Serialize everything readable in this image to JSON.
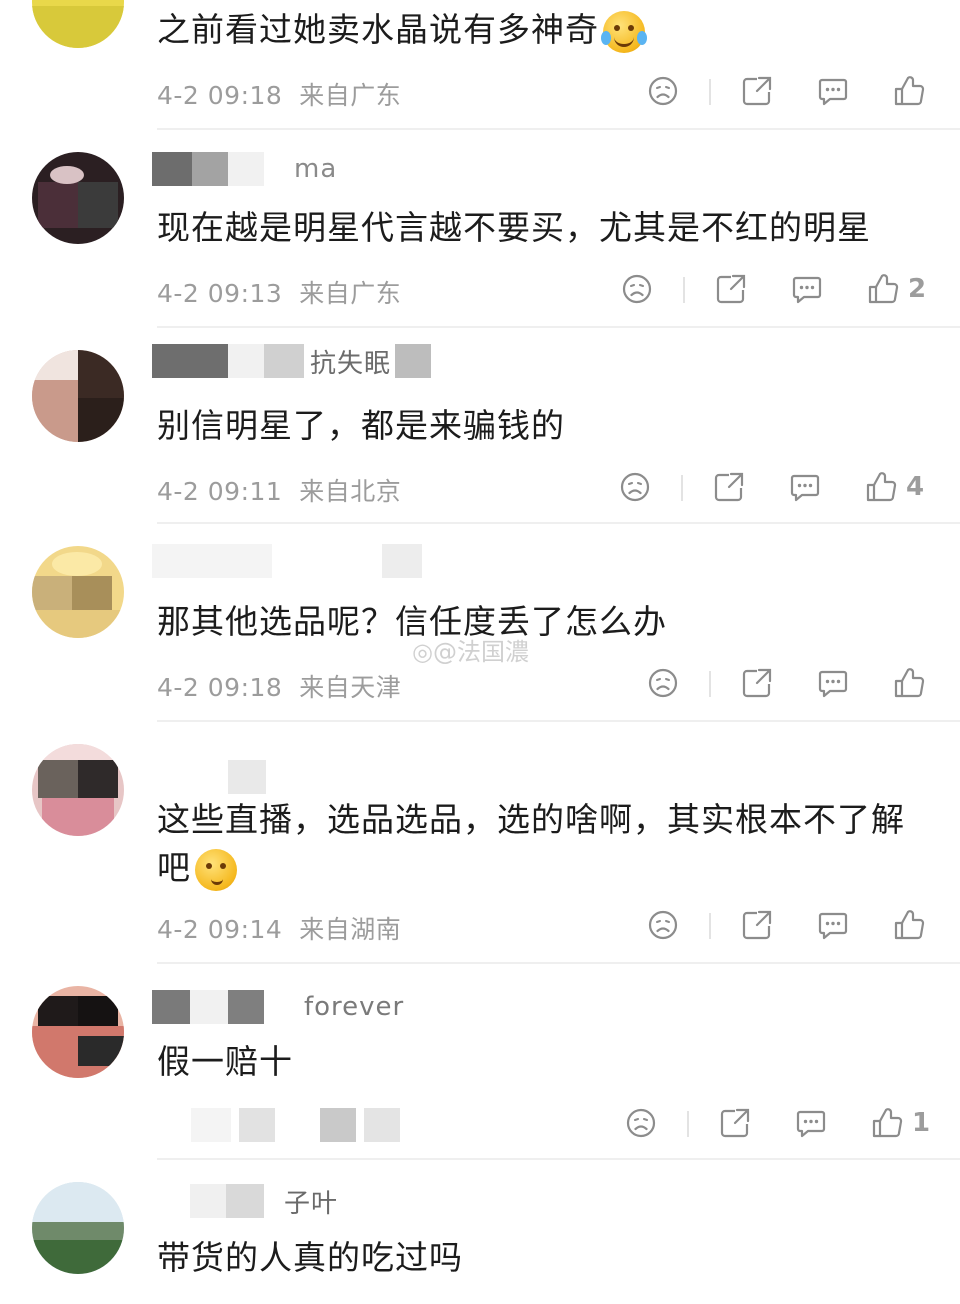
{
  "comments": [
    {
      "name": "",
      "text": "之前看过她卖水晶说有多神奇",
      "emoji": "crying-laughing-emoji",
      "time": "4-2 09:18",
      "location": "来自广东",
      "likes": ""
    },
    {
      "name": "ma",
      "text": "现在越是明星代言越不要买，尤其是不红的明星",
      "time": "4-2 09:13",
      "location": "来自广东",
      "likes": "2"
    },
    {
      "name": "抗失眠",
      "text": "别信明星了，都是来骗钱的",
      "time": "4-2 09:11",
      "location": "来自北京",
      "likes": "4"
    },
    {
      "name": "",
      "text": "那其他选品呢？信任度丢了怎么办",
      "time": "4-2 09:18",
      "location": "来自天津",
      "likes": ""
    },
    {
      "name": "",
      "text": "这些直播，选品选品，选的啥啊，其实根本不了解吧",
      "emoji": "thinking-emoji",
      "time": "4-2 09:14",
      "location": "来自湖南",
      "likes": ""
    },
    {
      "name": "forever",
      "text": "假一赔十",
      "time": "",
      "location": "",
      "likes": "1"
    },
    {
      "name": "子叶",
      "text": "带货的人真的吃过吗",
      "time": "",
      "location": "",
      "likes": ""
    }
  ],
  "watermark": "@法国濃",
  "colors": {
    "text": "#1c1c1c",
    "meta": "#9c9c9c",
    "icon": "#8c8c8c",
    "separator": "#efefef"
  },
  "icons": [
    "dislike-face-icon",
    "share-icon",
    "reply-comment-icon",
    "thumbs-up-icon"
  ]
}
